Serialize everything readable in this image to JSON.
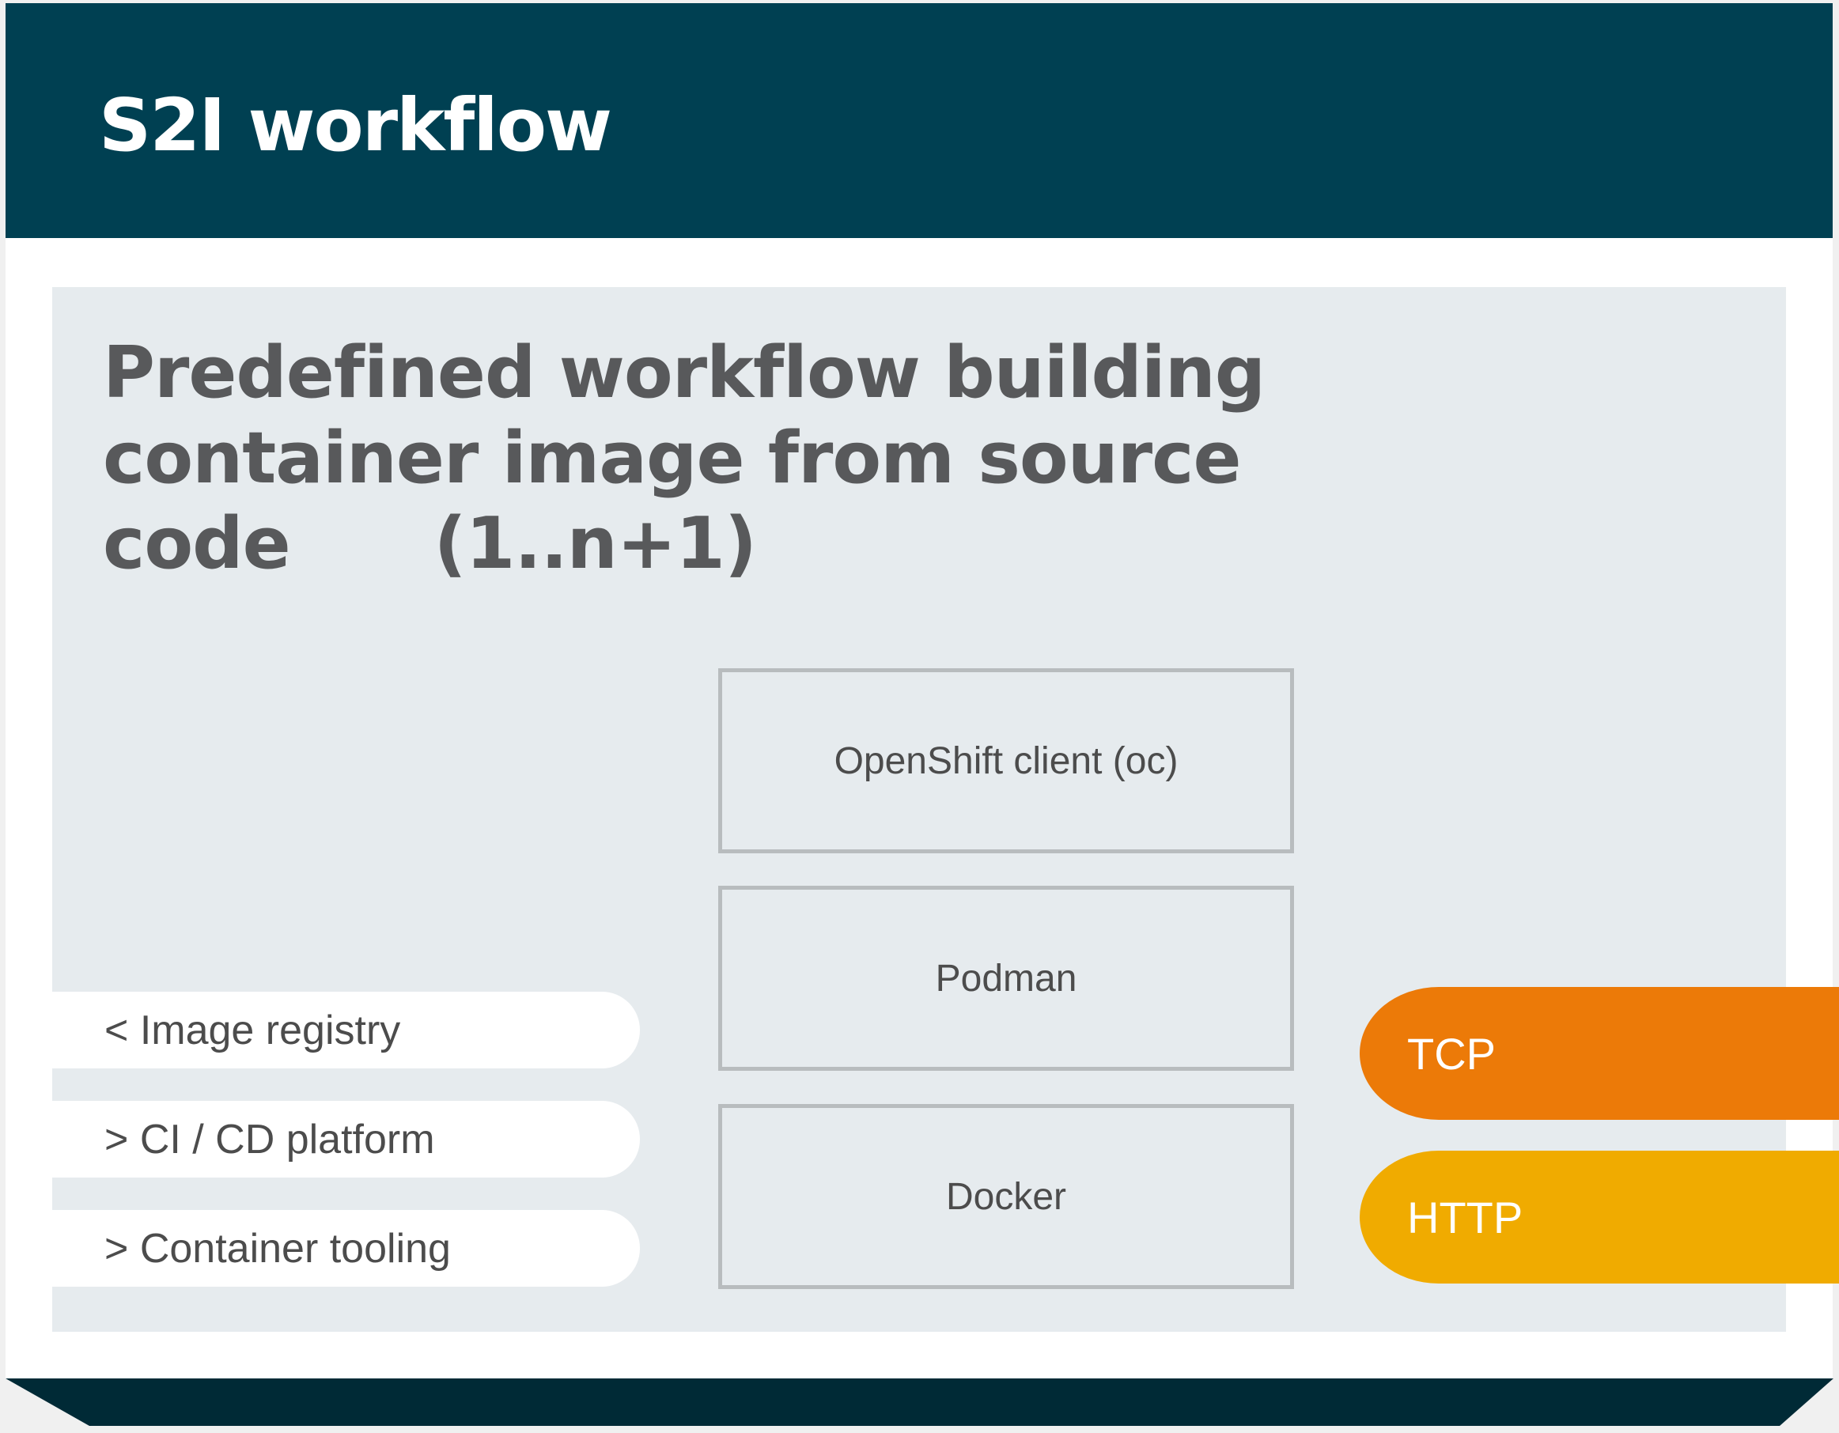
{
  "header": {
    "title": "S2I workflow",
    "background": "#004052"
  },
  "panel": {
    "headline": "Predefined workflow building\ncontainer image from source\ncode      (1..n+1)",
    "background": "#e6ebee"
  },
  "scope_items": [
    {
      "label": "< Image registry"
    },
    {
      "label": "> CI / CD platform"
    },
    {
      "label": "> Container tooling"
    }
  ],
  "tools": [
    {
      "label": "OpenShift client (oc)"
    },
    {
      "label": "Podman"
    },
    {
      "label": "Docker"
    }
  ],
  "protocols": [
    {
      "label": "TCP",
      "color": "#ec7a08"
    },
    {
      "label": "HTTP",
      "color": "#f0ab00"
    }
  ],
  "footer": {
    "color": "#002a36"
  }
}
